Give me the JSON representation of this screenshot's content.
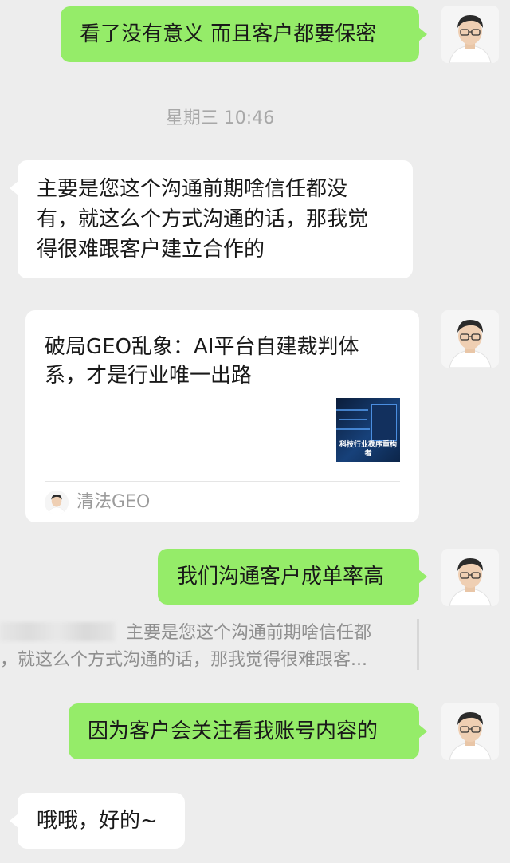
{
  "messages": {
    "m1": "看了没有意义 而且客户都要保密",
    "timestamp": "星期三 10:46",
    "m2": {
      "line1": "主要是您这个沟通前期啥信任都没",
      "line2": "有，就这么个方式沟通的话，那我觉",
      "line3": "得很难跟客户建立合作的"
    },
    "card": {
      "title_line1": "破局GEO乱象：AI平台自建裁判体",
      "title_line2": "系，才是行业唯一出路",
      "thumb_caption": "科技行业秩序重构者",
      "source": "清法GEO"
    },
    "m3": "我们沟通客户成单率高",
    "quote": {
      "line1": "主要是您这个沟通前期啥信任都",
      "line2": "，就这么个方式沟通的话，那我觉得很难跟客..."
    },
    "m4": "因为客户会关注看我账号内容的",
    "m5": "哦哦，好的~"
  },
  "colors": {
    "background": "#ededed",
    "sent_bubble": "#95ec69",
    "received_bubble": "#ffffff"
  }
}
